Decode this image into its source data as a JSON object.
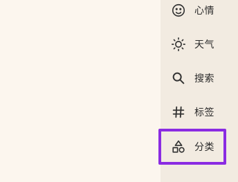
{
  "menu": {
    "items": [
      {
        "label": "心情",
        "icon": "smiley-icon"
      },
      {
        "label": "天气",
        "icon": "sun-icon"
      },
      {
        "label": "搜索",
        "icon": "search-icon"
      },
      {
        "label": "标签",
        "icon": "hashtag-icon"
      },
      {
        "label": "分类",
        "icon": "shapes-icon",
        "selected": true
      }
    ]
  },
  "colors": {
    "background": "#fcf6ee",
    "panel": "#f2ebe1",
    "highlight": "#8a2be2",
    "text": "#2b2b2b"
  }
}
